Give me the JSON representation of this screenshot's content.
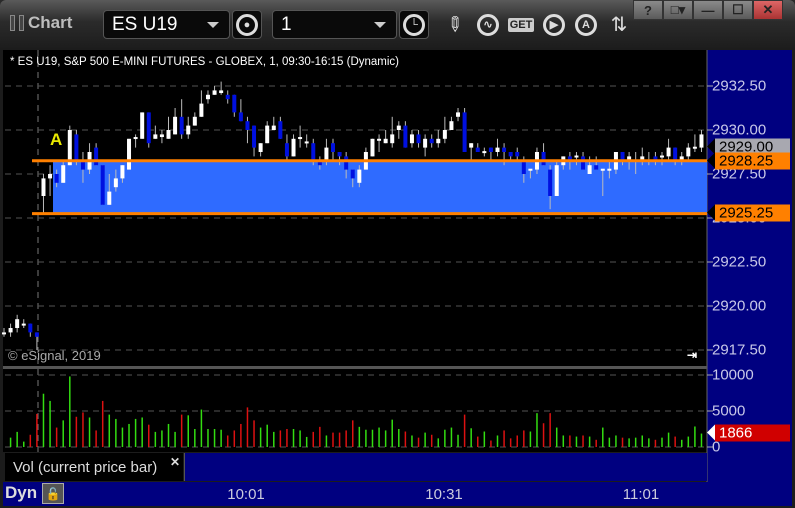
{
  "window": {
    "title": "Chart",
    "controls": [
      "?",
      "□▾",
      "—",
      "☐",
      "✕"
    ]
  },
  "toolbar": {
    "symbol": "ES U19",
    "interval": "1",
    "icons": [
      "settings-icon",
      "clock-icon",
      "pencil-icon",
      "study-icon",
      "get-icon",
      "play-icon",
      "alert-icon",
      "link-icon"
    ],
    "get_label": "GET",
    "alert_label": "A"
  },
  "chart": {
    "header": "* ES U19, S&P 500 E-MINI FUTURES - GLOBEX, 1, 09:30-16:15 (Dynamic)",
    "copyright": "© eSignal, 2019",
    "annotation": "A",
    "price_ticks": [
      "2932.50",
      "2930.00",
      "2927.50",
      "2925.00",
      "2922.50",
      "2920.00",
      "2917.50"
    ],
    "last_price": "2929.00",
    "upper_line": "2928.25",
    "lower_line": "2925.25",
    "volume_ticks": [
      "10000",
      "5000",
      "0"
    ],
    "last_volume": "1866",
    "volume_legend": "Vol (current price bar)",
    "time_ticks": [
      "10:01",
      "10:31",
      "11:01"
    ],
    "mode_label": "Dyn",
    "colors": {
      "up_candle": "#ffffff",
      "down_candle": "#0010e0",
      "zone": "#2f6bff",
      "zone_line": "#ff8000",
      "vol_up": "#33dd11",
      "vol_down": "#dd1111",
      "axis_bg": "#000080",
      "annotation": "#e8e800"
    }
  },
  "chart_data": {
    "type": "candlestick",
    "candles": [
      [
        2918.5,
        2918.75,
        2918.25,
        2918.5
      ],
      [
        2918.5,
        2919.0,
        2918.25,
        2918.75
      ],
      [
        2918.75,
        2919.5,
        2918.5,
        2919.25
      ],
      [
        2919.0,
        2919.25,
        2918.75,
        2919.0
      ],
      [
        2919.0,
        2919.0,
        2918.25,
        2918.5
      ],
      [
        2918.5,
        2918.5,
        2917.5,
        2918.25
      ],
      [
        2926.25,
        2927.5,
        2925.25,
        2927.25
      ],
      [
        2927.25,
        2928.0,
        2926.25,
        2927.5
      ],
      [
        2927.5,
        2927.75,
        2926.75,
        2927.0
      ],
      [
        2927.0,
        2928.25,
        2927.0,
        2928.0
      ],
      [
        2928.0,
        2930.25,
        2928.0,
        2930.0
      ],
      [
        2929.75,
        2930.0,
        2928.0,
        2928.25
      ],
      [
        2928.25,
        2928.75,
        2927.0,
        2927.75
      ],
      [
        2927.75,
        2929.25,
        2927.5,
        2928.75
      ],
      [
        2929.0,
        2929.25,
        2928.0,
        2928.0
      ],
      [
        2928.0,
        2928.0,
        2925.75,
        2925.75
      ],
      [
        2925.75,
        2927.5,
        2925.75,
        2926.5
      ],
      [
        2926.75,
        2927.75,
        2926.5,
        2927.25
      ],
      [
        2927.25,
        2928.0,
        2927.0,
        2928.0
      ],
      [
        2927.75,
        2929.5,
        2927.75,
        2929.5
      ],
      [
        2929.5,
        2929.75,
        2929.0,
        2929.6
      ],
      [
        2929.5,
        2931.0,
        2929.5,
        2931.0
      ],
      [
        2931.0,
        2931.0,
        2929.0,
        2929.25
      ],
      [
        2929.5,
        2930.25,
        2929.5,
        2929.75
      ],
      [
        2929.6,
        2930.0,
        2929.25,
        2929.75
      ],
      [
        2929.5,
        2930.75,
        2929.5,
        2930.0
      ],
      [
        2929.75,
        2931.25,
        2929.75,
        2930.75
      ],
      [
        2930.75,
        2931.75,
        2929.5,
        2929.75
      ],
      [
        2929.75,
        2930.75,
        2929.5,
        2930.25
      ],
      [
        2930.25,
        2931.0,
        2930.25,
        2930.75
      ],
      [
        2930.75,
        2932.25,
        2930.75,
        2931.5
      ],
      [
        2931.75,
        2932.25,
        2931.5,
        2932.0
      ],
      [
        2932.0,
        2932.5,
        2932.0,
        2932.25
      ],
      [
        2932.1,
        2932.75,
        2932.0,
        2932.25
      ],
      [
        2932.0,
        2932.25,
        2931.5,
        2931.75
      ],
      [
        2932.0,
        2932.0,
        2930.75,
        2931.0
      ],
      [
        2931.0,
        2931.75,
        2930.5,
        2930.5
      ],
      [
        2930.5,
        2930.75,
        2929.25,
        2930.0
      ],
      [
        2930.25,
        2930.25,
        2928.5,
        2929.0
      ],
      [
        2928.75,
        2929.25,
        2928.5,
        2929.25
      ],
      [
        2929.25,
        2930.5,
        2929.25,
        2930.25
      ],
      [
        2930.0,
        2930.75,
        2930.0,
        2930.25
      ],
      [
        2930.5,
        2930.75,
        2929.5,
        2929.5
      ],
      [
        2929.25,
        2929.75,
        2928.25,
        2928.5
      ],
      [
        2928.5,
        2929.75,
        2928.5,
        2929.5
      ],
      [
        2929.5,
        2930.25,
        2929.0,
        2929.6
      ],
      [
        2929.25,
        2929.75,
        2929.0,
        2929.35
      ],
      [
        2929.25,
        2929.5,
        2928.0,
        2928.25
      ],
      [
        2928.25,
        2928.5,
        2927.75,
        2928.0
      ],
      [
        2928.25,
        2929.5,
        2928.0,
        2929.0
      ],
      [
        2929.25,
        2929.5,
        2928.25,
        2928.75
      ],
      [
        2928.75,
        2928.75,
        2928.0,
        2928.5
      ],
      [
        2928.5,
        2928.75,
        2927.25,
        2927.75
      ],
      [
        2927.75,
        2927.75,
        2926.75,
        2927.25
      ],
      [
        2927.0,
        2928.0,
        2926.75,
        2927.75
      ],
      [
        2927.75,
        2929.0,
        2927.75,
        2928.75
      ],
      [
        2928.5,
        2929.5,
        2928.5,
        2929.5
      ],
      [
        2929.4,
        2929.75,
        2928.75,
        2929.5
      ],
      [
        2929.25,
        2930.0,
        2929.25,
        2929.5
      ],
      [
        2929.25,
        2930.75,
        2929.0,
        2929.75
      ],
      [
        2930.0,
        2930.5,
        2929.5,
        2930.25
      ],
      [
        2930.25,
        2930.5,
        2929.0,
        2929.0
      ],
      [
        2929.25,
        2930.0,
        2929.0,
        2929.75
      ],
      [
        2929.75,
        2930.0,
        2929.0,
        2929.25
      ],
      [
        2929.0,
        2929.75,
        2928.5,
        2929.5
      ],
      [
        2929.5,
        2929.75,
        2929.0,
        2929.25
      ],
      [
        2929.25,
        2930.0,
        2929.0,
        2929.5
      ],
      [
        2929.5,
        2930.75,
        2929.25,
        2930.0
      ],
      [
        2930.0,
        2930.75,
        2930.0,
        2930.5
      ],
      [
        2930.75,
        2931.25,
        2930.5,
        2931.0
      ],
      [
        2931.0,
        2931.25,
        2928.75,
        2928.75
      ],
      [
        2929.0,
        2929.25,
        2928.25,
        2929.25
      ],
      [
        2929.0,
        2929.25,
        2928.75,
        2928.75
      ],
      [
        2928.7,
        2929.0,
        2928.5,
        2928.8
      ],
      [
        2929.0,
        2929.0,
        2928.25,
        2928.75
      ],
      [
        2928.75,
        2929.5,
        2928.5,
        2929.0
      ],
      [
        2929.0,
        2929.25,
        2928.0,
        2928.75
      ],
      [
        2928.75,
        2928.75,
        2928.25,
        2928.5
      ],
      [
        2928.75,
        2929.0,
        2928.25,
        2928.5
      ],
      [
        2928.25,
        2928.5,
        2927.0,
        2927.5
      ],
      [
        2927.7,
        2927.75,
        2927.25,
        2927.8
      ],
      [
        2927.75,
        2929.0,
        2927.5,
        2928.75
      ],
      [
        2928.75,
        2929.25,
        2928.0,
        2928.0
      ],
      [
        2927.75,
        2928.0,
        2925.5,
        2926.25
      ],
      [
        2926.25,
        2928.25,
        2926.25,
        2928.0
      ],
      [
        2928.0,
        2928.5,
        2927.75,
        2928.5
      ],
      [
        2928.5,
        2928.75,
        2927.75,
        2928.25
      ],
      [
        2928.45,
        2928.75,
        2928.0,
        2928.55
      ],
      [
        2928.5,
        2928.75,
        2927.75,
        2927.75
      ],
      [
        2927.5,
        2928.5,
        2927.5,
        2928.0
      ],
      [
        2928.0,
        2928.5,
        2927.75,
        2927.75
      ],
      [
        2927.7,
        2927.75,
        2926.25,
        2927.8
      ],
      [
        2927.7,
        2928.25,
        2927.25,
        2927.8
      ],
      [
        2927.75,
        2928.75,
        2927.5,
        2928.75
      ],
      [
        2928.75,
        2928.75,
        2928.0,
        2928.25
      ],
      [
        2928.25,
        2928.75,
        2927.75,
        2928.5
      ],
      [
        2928.2,
        2928.75,
        2927.5,
        2928.3
      ],
      [
        2928.25,
        2929.0,
        2928.0,
        2928.5
      ],
      [
        2928.2,
        2928.75,
        2928.0,
        2928.3
      ],
      [
        2928.5,
        2928.75,
        2928.0,
        2928.25
      ],
      [
        2928.45,
        2928.75,
        2928.0,
        2928.55
      ],
      [
        2928.5,
        2929.5,
        2928.25,
        2929.0
      ],
      [
        2929.0,
        2929.0,
        2928.0,
        2928.25
      ],
      [
        2928.25,
        2928.75,
        2928.0,
        2928.5
      ],
      [
        2928.5,
        2929.25,
        2928.25,
        2929.0
      ],
      [
        2928.95,
        2929.75,
        2928.75,
        2929.05
      ],
      [
        2929.0,
        2930.0,
        2928.75,
        2929.75
      ]
    ],
    "volume": [
      1300,
      2100,
      750,
      1700,
      4600,
      7400,
      6400,
      2700,
      3700,
      9800,
      4200,
      4800,
      4100,
      2300,
      6400,
      4500,
      3900,
      2700,
      3200,
      3900,
      4100,
      3100,
      2100,
      2300,
      3200,
      2100,
      4500,
      4400,
      2500,
      5200,
      2500,
      2500,
      2400,
      1600,
      2300,
      3200,
      5500,
      3700,
      2700,
      3100,
      2100,
      2300,
      2500,
      2500,
      2300,
      1400,
      2100,
      2800,
      1600,
      2000,
      2000,
      2300,
      3700,
      2800,
      2400,
      2400,
      2700,
      2300,
      3800,
      2500,
      2150,
      1600,
      1300,
      2000,
      1700,
      1200,
      2400,
      2700,
      1700,
      4500,
      2600,
      1450,
      2150,
      900,
      1600,
      2300,
      1200,
      1600,
      2300,
      2150,
      4700,
      3300,
      4700,
      2700,
      1600,
      1600,
      1450,
      1600,
      1450,
      1000,
      2700,
      1300,
      1600,
      1300,
      1200,
      1300,
      1600,
      1200,
      1000,
      1300,
      2000,
      1450,
      1000,
      1450,
      2850,
      1866
    ],
    "volume_direction": "gggrrggrggrrgrrggggggrggggrggggggrrrrrgggrrgggrrgrrrrgggggggrgrgrggggrgrgrgrrrrggrrggrgrgrgggrggggrggrgggg",
    "price_range": [
      2916.75,
      2936.5
    ],
    "volume_range": [
      0,
      11000
    ],
    "zone": {
      "upper": 2928.25,
      "lower": 2925.25
    }
  }
}
